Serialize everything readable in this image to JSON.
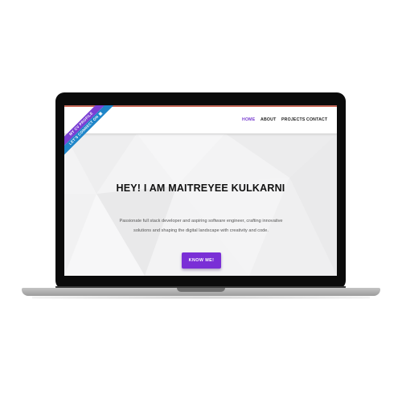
{
  "ribbon": {
    "line1": "MY CV PROFILE",
    "line2": "LET'S CONNECT ON",
    "icon": "linkedin-icon"
  },
  "nav": {
    "items": [
      {
        "label": "HOME",
        "active": true
      },
      {
        "label": "ABOUT",
        "active": false
      },
      {
        "label": "PROJECTS",
        "active": false
      },
      {
        "label": "CONTACT",
        "active": false
      }
    ]
  },
  "hero": {
    "title": "HEY! I AM MAITREYEE KULKARNI",
    "description": "Passionate full stack developer and aspiring software engineer, crafting innovative solutions and shaping the digital landscape with creativity and code.",
    "cta_label": "KNOW ME!"
  },
  "colors": {
    "accent": "#7a2fd6",
    "ribbon_purple": "#7b3fd4",
    "ribbon_blue": "#1f86c9",
    "nav_active": "#7a3fd0"
  }
}
